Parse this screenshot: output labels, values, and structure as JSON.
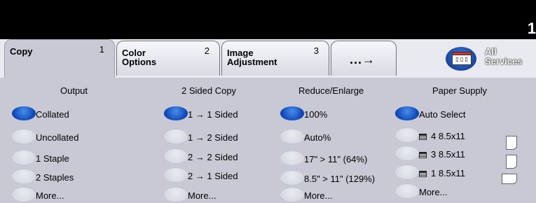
{
  "header": {
    "page_indicator": "1"
  },
  "tabs": [
    {
      "label": "Copy",
      "number": "1"
    },
    {
      "label": "Color\nOptions",
      "number": "2"
    },
    {
      "label": "Image\nAdjustment",
      "number": "3"
    },
    {
      "label": "...→"
    }
  ],
  "all_services": {
    "label": "All\nServices",
    "icon": "all-services-icon"
  },
  "output": {
    "title": "Output",
    "options": [
      "Collated",
      "Uncollated",
      "1 Staple",
      "2 Staples",
      "More..."
    ],
    "selected": "Collated"
  },
  "two_sided": {
    "title": "2 Sided Copy",
    "options": [
      "1 → 1 Sided",
      "1 → 2 Sided",
      "2 → 2 Sided",
      "2 → 1 Sided",
      "More..."
    ],
    "selected": "1 → 1 Sided"
  },
  "reduce": {
    "title": "Reduce/Enlarge",
    "options": [
      "100%",
      "Auto%",
      "17\"  >  11\"  (64%)",
      "8.5\" > 11\"  (129%)",
      "More..."
    ],
    "selected": "100%"
  },
  "paper": {
    "title": "Paper Supply",
    "options": [
      "Auto Select",
      "4   8.5x11",
      "3   8.5x11",
      "1   8.5x11",
      "More..."
    ],
    "selected": "Auto Select"
  },
  "colors": {
    "selected": "#0d47b8",
    "panel": "#c8c9d4",
    "tabs_bg": "#e9eaef"
  }
}
